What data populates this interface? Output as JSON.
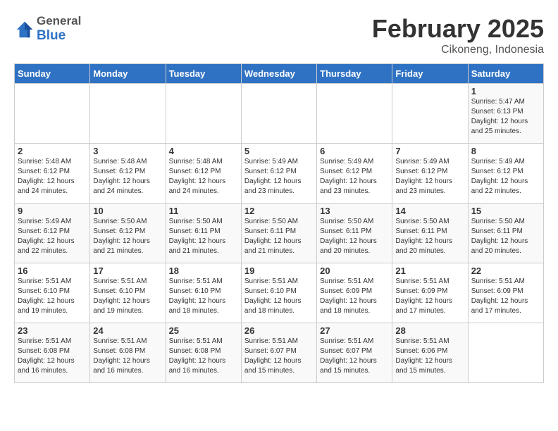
{
  "logo": {
    "general": "General",
    "blue": "Blue"
  },
  "title": "February 2025",
  "subtitle": "Cikoneng, Indonesia",
  "headers": [
    "Sunday",
    "Monday",
    "Tuesday",
    "Wednesday",
    "Thursday",
    "Friday",
    "Saturday"
  ],
  "weeks": [
    [
      {
        "day": "",
        "info": ""
      },
      {
        "day": "",
        "info": ""
      },
      {
        "day": "",
        "info": ""
      },
      {
        "day": "",
        "info": ""
      },
      {
        "day": "",
        "info": ""
      },
      {
        "day": "",
        "info": ""
      },
      {
        "day": "1",
        "info": "Sunrise: 5:47 AM\nSunset: 6:13 PM\nDaylight: 12 hours\nand 25 minutes."
      }
    ],
    [
      {
        "day": "2",
        "info": "Sunrise: 5:48 AM\nSunset: 6:12 PM\nDaylight: 12 hours\nand 24 minutes."
      },
      {
        "day": "3",
        "info": "Sunrise: 5:48 AM\nSunset: 6:12 PM\nDaylight: 12 hours\nand 24 minutes."
      },
      {
        "day": "4",
        "info": "Sunrise: 5:48 AM\nSunset: 6:12 PM\nDaylight: 12 hours\nand 24 minutes."
      },
      {
        "day": "5",
        "info": "Sunrise: 5:49 AM\nSunset: 6:12 PM\nDaylight: 12 hours\nand 23 minutes."
      },
      {
        "day": "6",
        "info": "Sunrise: 5:49 AM\nSunset: 6:12 PM\nDaylight: 12 hours\nand 23 minutes."
      },
      {
        "day": "7",
        "info": "Sunrise: 5:49 AM\nSunset: 6:12 PM\nDaylight: 12 hours\nand 23 minutes."
      },
      {
        "day": "8",
        "info": "Sunrise: 5:49 AM\nSunset: 6:12 PM\nDaylight: 12 hours\nand 22 minutes."
      }
    ],
    [
      {
        "day": "9",
        "info": "Sunrise: 5:49 AM\nSunset: 6:12 PM\nDaylight: 12 hours\nand 22 minutes."
      },
      {
        "day": "10",
        "info": "Sunrise: 5:50 AM\nSunset: 6:12 PM\nDaylight: 12 hours\nand 21 minutes."
      },
      {
        "day": "11",
        "info": "Sunrise: 5:50 AM\nSunset: 6:11 PM\nDaylight: 12 hours\nand 21 minutes."
      },
      {
        "day": "12",
        "info": "Sunrise: 5:50 AM\nSunset: 6:11 PM\nDaylight: 12 hours\nand 21 minutes."
      },
      {
        "day": "13",
        "info": "Sunrise: 5:50 AM\nSunset: 6:11 PM\nDaylight: 12 hours\nand 20 minutes."
      },
      {
        "day": "14",
        "info": "Sunrise: 5:50 AM\nSunset: 6:11 PM\nDaylight: 12 hours\nand 20 minutes."
      },
      {
        "day": "15",
        "info": "Sunrise: 5:50 AM\nSunset: 6:11 PM\nDaylight: 12 hours\nand 20 minutes."
      }
    ],
    [
      {
        "day": "16",
        "info": "Sunrise: 5:51 AM\nSunset: 6:10 PM\nDaylight: 12 hours\nand 19 minutes."
      },
      {
        "day": "17",
        "info": "Sunrise: 5:51 AM\nSunset: 6:10 PM\nDaylight: 12 hours\nand 19 minutes."
      },
      {
        "day": "18",
        "info": "Sunrise: 5:51 AM\nSunset: 6:10 PM\nDaylight: 12 hours\nand 18 minutes."
      },
      {
        "day": "19",
        "info": "Sunrise: 5:51 AM\nSunset: 6:10 PM\nDaylight: 12 hours\nand 18 minutes."
      },
      {
        "day": "20",
        "info": "Sunrise: 5:51 AM\nSunset: 6:09 PM\nDaylight: 12 hours\nand 18 minutes."
      },
      {
        "day": "21",
        "info": "Sunrise: 5:51 AM\nSunset: 6:09 PM\nDaylight: 12 hours\nand 17 minutes."
      },
      {
        "day": "22",
        "info": "Sunrise: 5:51 AM\nSunset: 6:09 PM\nDaylight: 12 hours\nand 17 minutes."
      }
    ],
    [
      {
        "day": "23",
        "info": "Sunrise: 5:51 AM\nSunset: 6:08 PM\nDaylight: 12 hours\nand 16 minutes."
      },
      {
        "day": "24",
        "info": "Sunrise: 5:51 AM\nSunset: 6:08 PM\nDaylight: 12 hours\nand 16 minutes."
      },
      {
        "day": "25",
        "info": "Sunrise: 5:51 AM\nSunset: 6:08 PM\nDaylight: 12 hours\nand 16 minutes."
      },
      {
        "day": "26",
        "info": "Sunrise: 5:51 AM\nSunset: 6:07 PM\nDaylight: 12 hours\nand 15 minutes."
      },
      {
        "day": "27",
        "info": "Sunrise: 5:51 AM\nSunset: 6:07 PM\nDaylight: 12 hours\nand 15 minutes."
      },
      {
        "day": "28",
        "info": "Sunrise: 5:51 AM\nSunset: 6:06 PM\nDaylight: 12 hours\nand 15 minutes."
      },
      {
        "day": "",
        "info": ""
      }
    ]
  ]
}
